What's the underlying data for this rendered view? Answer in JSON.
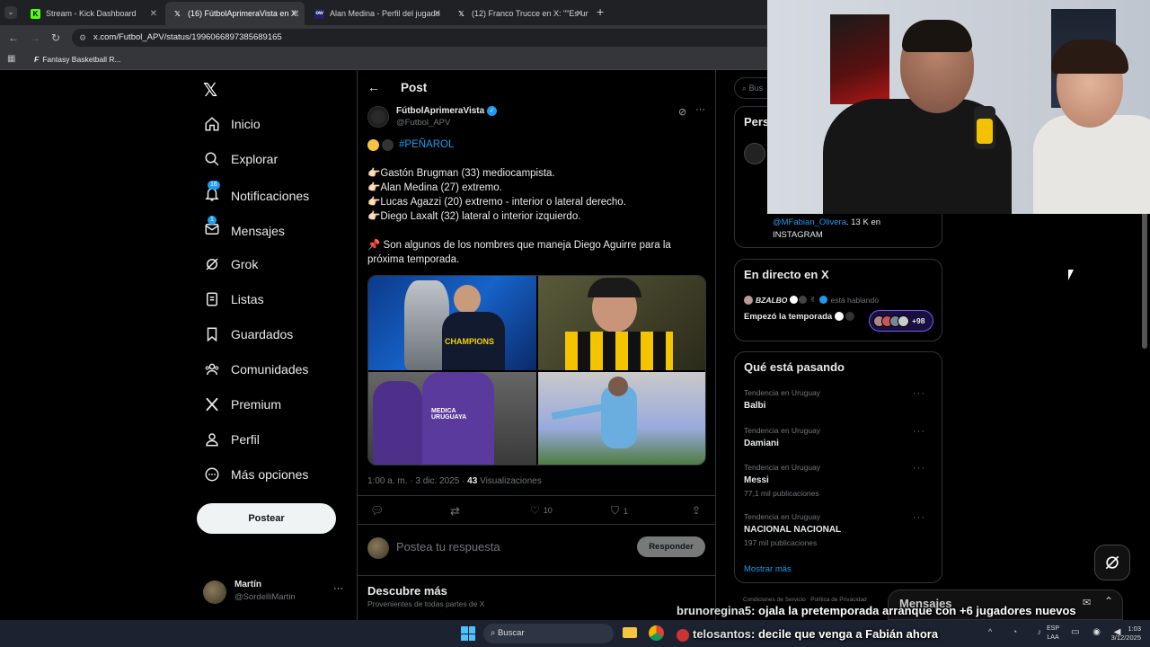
{
  "browser": {
    "tabs": [
      {
        "title": "Stream - Kick Dashboard",
        "active": false
      },
      {
        "title": "(16) FútbolAprimeraVista en X:",
        "active": true
      },
      {
        "title": "Alan Medina - Perfil del jugado",
        "active": false
      },
      {
        "title": "(12) Franco Trucce en X: \"\"Es un",
        "active": false
      }
    ],
    "url": "x.com/Futbol_APV/status/1996066897385689165",
    "bookmark": "Fantasy Basketball R..."
  },
  "nav": {
    "items": [
      {
        "label": "Inicio",
        "icon": "home-icon"
      },
      {
        "label": "Explorar",
        "icon": "search-icon"
      },
      {
        "label": "Notificaciones",
        "icon": "bell-icon",
        "badge": "16"
      },
      {
        "label": "Mensajes",
        "icon": "mail-icon",
        "badge": "1"
      },
      {
        "label": "Grok",
        "icon": "grok-icon"
      },
      {
        "label": "Listas",
        "icon": "list-icon"
      },
      {
        "label": "Guardados",
        "icon": "bookmark-icon"
      },
      {
        "label": "Comunidades",
        "icon": "people-icon"
      },
      {
        "label": "Premium",
        "icon": "x-logo-icon"
      },
      {
        "label": "Perfil",
        "icon": "person-icon"
      },
      {
        "label": "Más opciones",
        "icon": "more-circle-icon"
      }
    ],
    "post_button": "Postear",
    "account": {
      "name": "Martín",
      "handle": "@SordelliMartin"
    }
  },
  "post": {
    "header": "Post",
    "author": "FútbolAprimeraVista",
    "handle": "@Futbol_APV",
    "hashtag": "#PEÑAROL",
    "lines": [
      "Gastón Brugman (33) mediocampista.",
      "Alan Medina (27) extremo.",
      "Lucas  Agazzi (20) extremo - interior o lateral derecho.",
      "Diego Laxalt (32) lateral o interior izquierdo."
    ],
    "closing": "Son algunos de los nombres que maneja Diego Aguirre para la próxima temporada.",
    "timestamp": "1:00 a. m. · 3 dic. 2025 · ",
    "views_count": "43",
    "views_label": " Visualizaciones",
    "likes": "10",
    "bookmarks": "1",
    "photo_text": "CHAMPIONS",
    "reply_placeholder": "Postea tu respuesta",
    "reply_button": "Responder",
    "discover_title": "Descubre más",
    "discover_sub": "Provenientes de todas partes de X"
  },
  "sidebar": {
    "search_placeholder": "Bus",
    "persons_title": "Pers",
    "persons_line1": "@MFabian_Olivera",
    "persons_line1b": ". 13 K en",
    "persons_line2": "INSTAGRAM",
    "live_title": "En directo en X",
    "live_host": "BZALBO",
    "live_status": "está hablando",
    "live_room": "Empezó la temporada",
    "live_count": "+98",
    "trends_title": "Qué está pasando",
    "trends": [
      {
        "category": "Tendencia en Uruguay",
        "name": "Balbi",
        "count": ""
      },
      {
        "category": "Tendencia en Uruguay",
        "name": "Damiani",
        "count": ""
      },
      {
        "category": "Tendencia en Uruguay",
        "name": "Messi",
        "count": "77,1 mil publicaciones"
      },
      {
        "category": "Tendencia en Uruguay",
        "name": "NACIONAL NACIONAL",
        "count": "197 mil publicaciones"
      }
    ],
    "show_more": "Mostrar más",
    "footer": "Condiciones de Servicio   Política de Privacidad",
    "messages_dock": "Mensajes"
  },
  "chat": [
    {
      "user": "brunoregina5",
      "text": ": ojala la pretemporada arranque con +6 jugadores nuevos"
    },
    {
      "user": "telosantos",
      "text": ": decile que venga a Fabián ahora"
    }
  ],
  "taskbar": {
    "search": "Buscar",
    "lang1": "ESP",
    "lang2": "LAA",
    "time": "1:03",
    "date": "3/12/2025"
  }
}
